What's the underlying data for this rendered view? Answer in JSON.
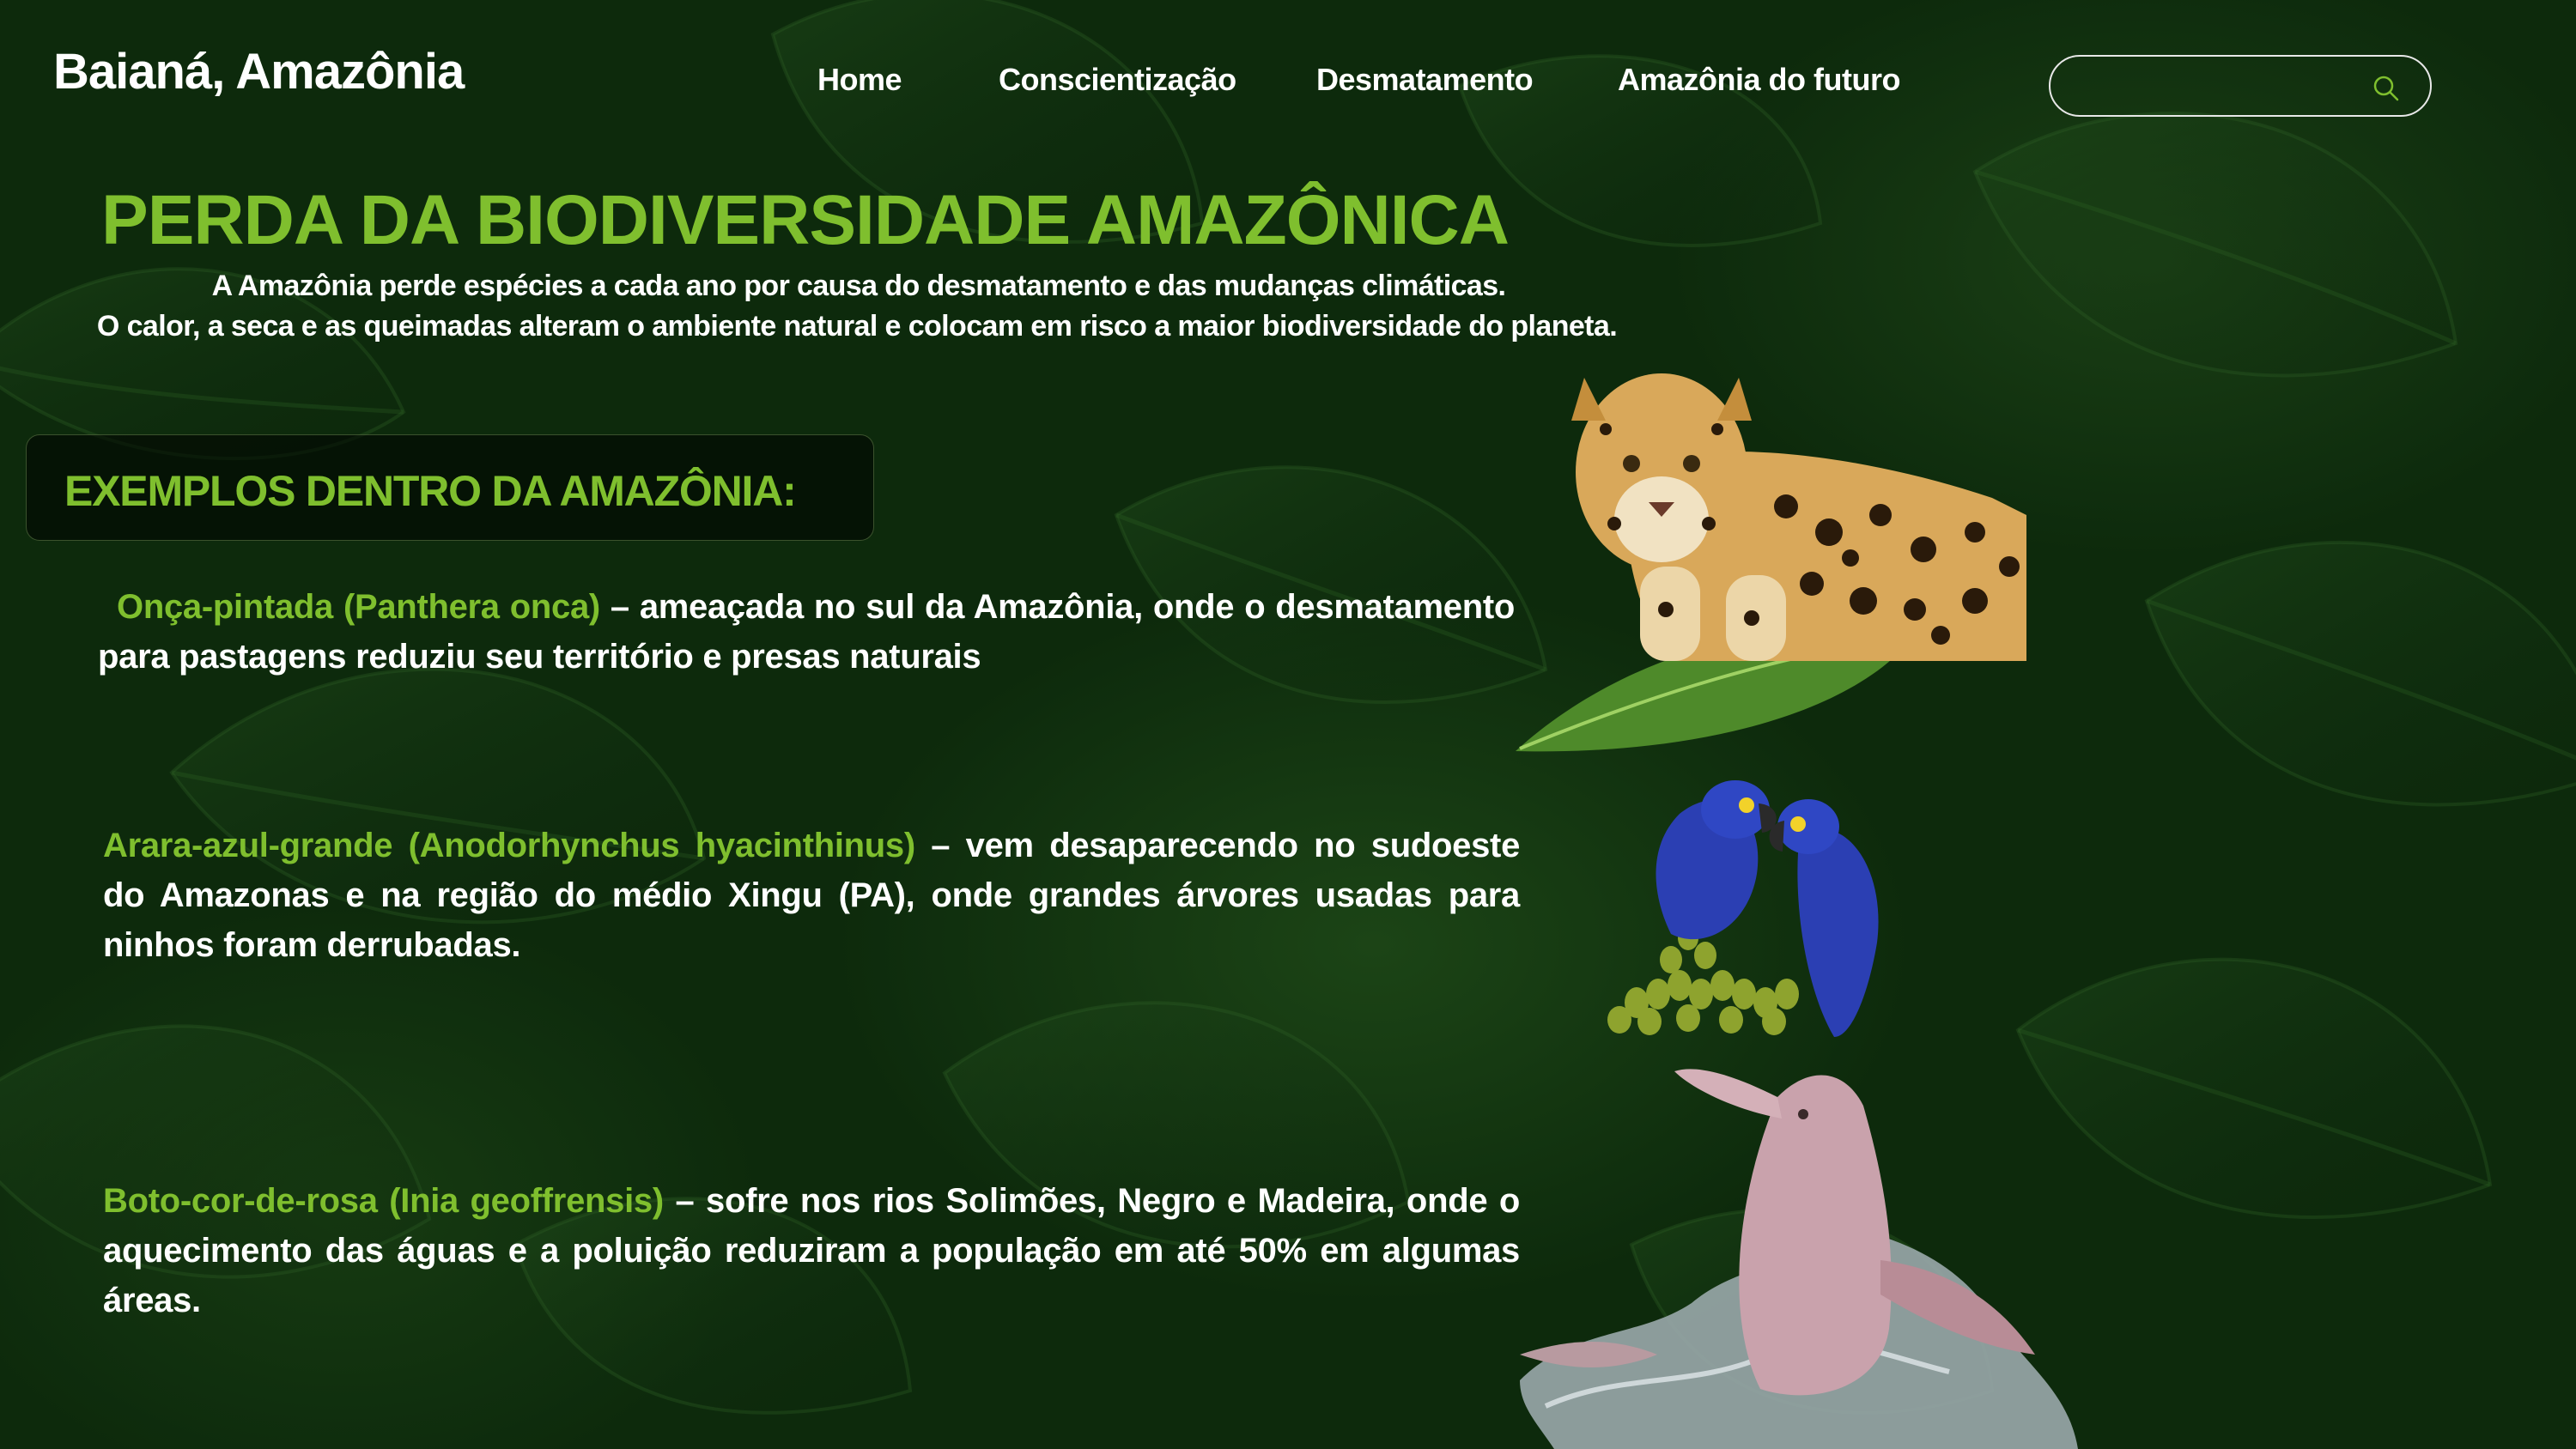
{
  "header": {
    "brand": "Baianá, Amazônia",
    "nav": [
      {
        "label": "Home"
      },
      {
        "label": "Conscientização"
      },
      {
        "label": "Desmatamento"
      },
      {
        "label": "Amazônia do futuro"
      }
    ],
    "search": {
      "value": "",
      "placeholder": "",
      "icon": "search-icon"
    }
  },
  "hero": {
    "title": "PERDA DA BIODIVERSIDADE AMAZÔNICA",
    "subtitle_line1": "A Amazônia perde espécies a cada ano por causa do desmatamento e das mudanças climáticas.",
    "subtitle_line2": "O calor, a seca e as queimadas alteram o ambiente natural e colocam em risco a maior biodiversidade do planeta."
  },
  "examples": {
    "heading": "EXEMPLOS DENTRO DA AMAZÔNIA:",
    "items": [
      {
        "name": "Onça-pintada (Panthera onca)",
        "text": " – ameaçada no sul da Amazônia,  onde o desmatamento para pastagens reduziu seu território e presas naturais",
        "image": "jaguar-image"
      },
      {
        "name": "Arara-azul-grande (Anodorhynchus hyacinthinus)",
        "text": " – vem desaparecendo no sudoeste do Amazonas e na região  do médio Xingu (PA), onde grandes árvores usadas para ninhos foram derrubadas.",
        "image": "macaw-image"
      },
      {
        "name": "Boto-cor-de-rosa (Inia geoffrensis)",
        "text": " – sofre nos rios Solimões, Negro e Madeira, onde o aquecimento das águas e a poluição reduziram a população em até 50% em algumas áreas.",
        "image": "dolphin-image"
      }
    ]
  },
  "colors": {
    "accent_green": "#7fbf2e",
    "background": "#0d2a0c",
    "text": "#ffffff"
  }
}
